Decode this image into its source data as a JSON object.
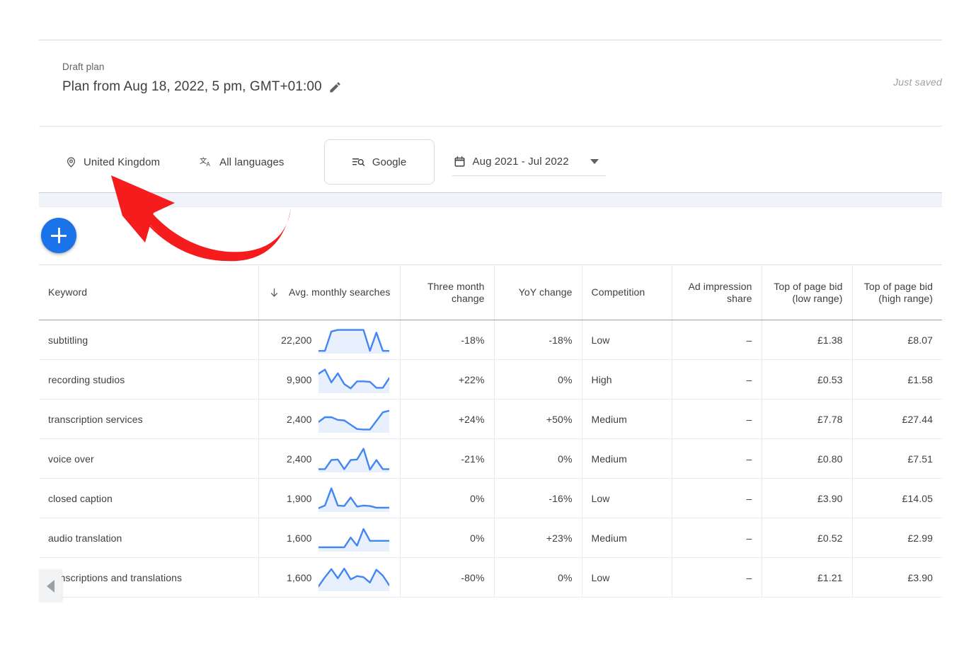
{
  "header": {
    "draft_label": "Draft plan",
    "plan_title": "Plan from Aug 18, 2022, 5 pm, GMT+01:00",
    "edit_icon": "pencil-icon",
    "save_status": "Just saved"
  },
  "toolbar": {
    "location": {
      "label": "United Kingdom",
      "icon": "location-pin-icon"
    },
    "language": {
      "label": "All languages",
      "icon": "translate-icon"
    },
    "network": {
      "label": "Google",
      "icon": "search-list-icon"
    },
    "date_range": {
      "label": "Aug 2021 - Jul 2022",
      "icon": "calendar-icon",
      "caret": "chevron-down-icon"
    }
  },
  "actions": {
    "add_keywords_label": "+",
    "add_keywords_icon": "plus-icon",
    "scroll_left_icon": "triangle-left-icon"
  },
  "annotation": {
    "arrow_color": "#f41c1c",
    "points_to": "United Kingdom"
  },
  "colors": {
    "accent_blue": "#1a73e8",
    "spark_line": "#4285f4",
    "spark_fill": "#e8f0fe",
    "text_primary": "#3c4043",
    "text_secondary": "#5f6368",
    "border": "#e8eaed"
  },
  "table": {
    "sort": {
      "column": "Avg. monthly searches",
      "direction": "descending",
      "icon": "arrow-down-icon"
    },
    "columns": [
      {
        "key": "keyword",
        "label": "Keyword",
        "align": "left"
      },
      {
        "key": "avg_monthly_searches",
        "label": "Avg. monthly searches",
        "align": "right"
      },
      {
        "key": "three_month_change",
        "label": "Three month change",
        "align": "right"
      },
      {
        "key": "yoy_change",
        "label": "YoY change",
        "align": "right"
      },
      {
        "key": "competition",
        "label": "Competition",
        "align": "left"
      },
      {
        "key": "ad_impression_share",
        "label": "Ad impression share",
        "align": "right"
      },
      {
        "key": "top_of_page_bid_low",
        "label": "Top of page bid (low range)",
        "align": "right"
      },
      {
        "key": "top_of_page_bid_high",
        "label": "Top of page bid (high range)",
        "align": "right"
      }
    ],
    "rows": [
      {
        "keyword": "subtitling",
        "avg_monthly_searches": "22,200",
        "three_month_change": "-18%",
        "yoy_change": "-18%",
        "competition": "Low",
        "ad_impression_share": "–",
        "top_of_page_bid_low": "£1.38",
        "top_of_page_bid_high": "£8.07",
        "sparkline": [
          10,
          10,
          82,
          88,
          88,
          88,
          88,
          88,
          10,
          78,
          10,
          10
        ]
      },
      {
        "keyword": "recording studios",
        "avg_monthly_searches": "9,900",
        "three_month_change": "+22%",
        "yoy_change": "0%",
        "competition": "High",
        "ad_impression_share": "–",
        "top_of_page_bid_low": "£0.53",
        "top_of_page_bid_high": "£1.58",
        "sparkline": [
          72,
          88,
          40,
          74,
          34,
          18,
          44,
          44,
          42,
          20,
          20,
          56
        ]
      },
      {
        "keyword": "transcription services",
        "avg_monthly_searches": "2,400",
        "three_month_change": "+24%",
        "yoy_change": "+50%",
        "competition": "Medium",
        "ad_impression_share": "–",
        "top_of_page_bid_low": "£7.78",
        "top_of_page_bid_high": "£27.44",
        "sparkline": [
          40,
          58,
          58,
          48,
          46,
          30,
          14,
          12,
          12,
          44,
          76,
          82
        ]
      },
      {
        "keyword": "voice over",
        "avg_monthly_searches": "2,400",
        "three_month_change": "-21%",
        "yoy_change": "0%",
        "competition": "Medium",
        "ad_impression_share": "–",
        "top_of_page_bid_low": "£0.80",
        "top_of_page_bid_high": "£7.51",
        "sparkline": [
          12,
          12,
          46,
          48,
          12,
          46,
          48,
          88,
          10,
          46,
          12,
          12
        ]
      },
      {
        "keyword": "closed caption",
        "avg_monthly_searches": "1,900",
        "three_month_change": "0%",
        "yoy_change": "-16%",
        "competition": "Low",
        "ad_impression_share": "–",
        "top_of_page_bid_low": "£3.90",
        "top_of_page_bid_high": "£14.05",
        "sparkline": [
          14,
          24,
          88,
          24,
          22,
          54,
          20,
          24,
          22,
          16,
          16,
          16
        ]
      },
      {
        "keyword": "audio translation",
        "avg_monthly_searches": "1,600",
        "three_month_change": "0%",
        "yoy_change": "+23%",
        "competition": "Medium",
        "ad_impression_share": "–",
        "top_of_page_bid_low": "£0.52",
        "top_of_page_bid_high": "£2.99",
        "sparkline": [
          16,
          16,
          16,
          16,
          16,
          52,
          22,
          84,
          40,
          40,
          40,
          40
        ]
      },
      {
        "keyword": "transcriptions and translations",
        "avg_monthly_searches": "1,600",
        "three_month_change": "-80%",
        "yoy_change": "0%",
        "competition": "Low",
        "ad_impression_share": "–",
        "top_of_page_bid_low": "£1.21",
        "top_of_page_bid_high": "£3.90",
        "sparkline": [
          18,
          52,
          82,
          48,
          84,
          44,
          56,
          52,
          32,
          80,
          58,
          22
        ]
      }
    ]
  }
}
